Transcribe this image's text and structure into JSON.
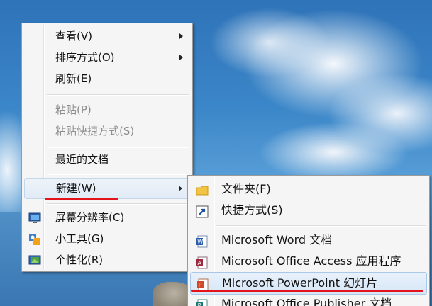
{
  "context_menu": {
    "items": [
      {
        "label": "查看(V)",
        "submenu": true,
        "disabled": false
      },
      {
        "label": "排序方式(O)",
        "submenu": true,
        "disabled": false
      },
      {
        "label": "刷新(E)",
        "submenu": false,
        "disabled": false
      },
      {
        "label": "粘贴(P)",
        "submenu": false,
        "disabled": true
      },
      {
        "label": "粘贴快捷方式(S)",
        "submenu": false,
        "disabled": true
      },
      {
        "label": "最近的文档",
        "submenu": false,
        "disabled": false
      },
      {
        "label": "新建(W)",
        "submenu": true,
        "disabled": false
      },
      {
        "label": "屏幕分辨率(C)",
        "icon": "display-icon",
        "disabled": false
      },
      {
        "label": "小工具(G)",
        "icon": "gadgets-icon",
        "disabled": false
      },
      {
        "label": "个性化(R)",
        "icon": "personalize-icon",
        "disabled": false
      }
    ]
  },
  "new_submenu": {
    "items": [
      {
        "label": "文件夹(F)",
        "icon": "folder-icon"
      },
      {
        "label": "快捷方式(S)",
        "icon": "shortcut-icon"
      },
      {
        "label": "Microsoft Word 文档",
        "icon": "word-icon"
      },
      {
        "label": "Microsoft Office Access 应用程序",
        "icon": "access-icon"
      },
      {
        "label": "Microsoft PowerPoint 幻灯片",
        "icon": "powerpoint-icon"
      },
      {
        "label": "Microsoft Office Publisher 文档",
        "icon": "publisher-icon"
      }
    ]
  },
  "colors": {
    "highlight_underline": "#e3131b",
    "menu_background": "#f5f5f5"
  }
}
